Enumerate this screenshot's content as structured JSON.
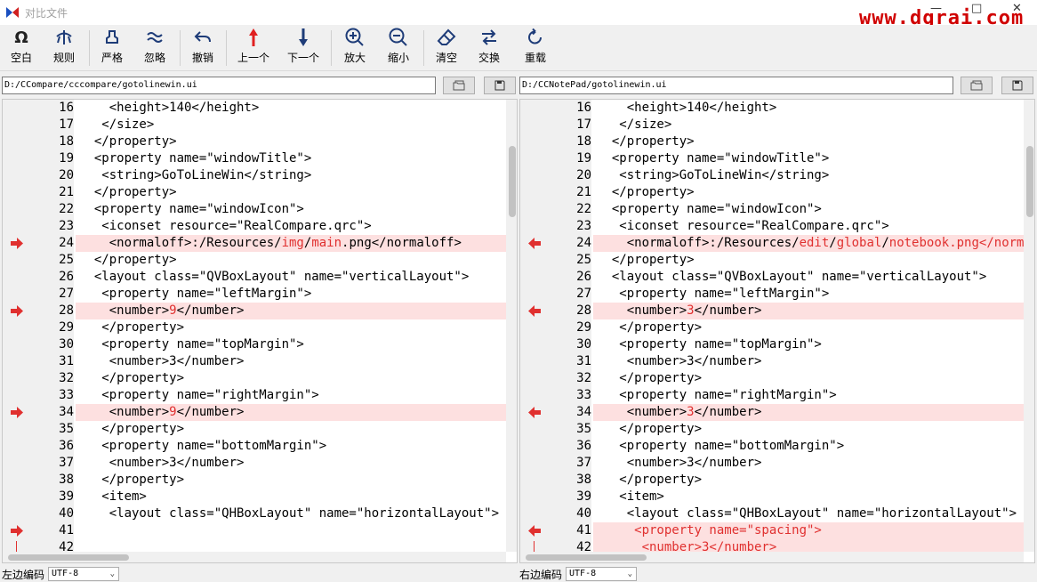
{
  "window": {
    "title": "对比文件",
    "watermark": "www.dgrai.com",
    "minimize": "—",
    "maximize": "□",
    "close": "✕"
  },
  "toolbar": {
    "blank": "空白",
    "rules": "规则",
    "strict": "严格",
    "ignore": "忽略",
    "undo": "撤销",
    "prev": "上一个",
    "next": "下一个",
    "zoom_in": "放大",
    "zoom_out": "缩小",
    "clear": "清空",
    "swap": "交换",
    "reload": "重载"
  },
  "left": {
    "path": "D:/CCompare/cccompare/gotolinewin.ui",
    "encoding_label": "左边编码",
    "encoding": "UTF-8",
    "lines": [
      {
        "n": "16",
        "segs": [
          {
            "t": "    <height>140</height>"
          }
        ]
      },
      {
        "n": "17",
        "segs": [
          {
            "t": "   </size>"
          }
        ]
      },
      {
        "n": "18",
        "segs": [
          {
            "t": "  </property>"
          }
        ]
      },
      {
        "n": "19",
        "segs": [
          {
            "t": "  <property name=\"windowTitle\">"
          }
        ]
      },
      {
        "n": "20",
        "segs": [
          {
            "t": "   <string>GoToLineWin</string>"
          }
        ]
      },
      {
        "n": "21",
        "segs": [
          {
            "t": "  </property>"
          }
        ]
      },
      {
        "n": "22",
        "segs": [
          {
            "t": "  <property name=\"windowIcon\">"
          }
        ]
      },
      {
        "n": "23",
        "segs": [
          {
            "t": "   <iconset resource=\"RealCompare.qrc\">"
          }
        ]
      },
      {
        "n": "24",
        "diff": true,
        "segs": [
          {
            "t": "    <normaloff>:/Resources/"
          },
          {
            "t": "img",
            "r": true
          },
          {
            "t": "/"
          },
          {
            "t": "main",
            "r": true
          },
          {
            "t": ".png</normaloff>"
          }
        ]
      },
      {
        "n": "25",
        "segs": [
          {
            "t": "  </property>"
          }
        ]
      },
      {
        "n": "26",
        "segs": [
          {
            "t": "  <layout class=\"QVBoxLayout\" name=\"verticalLayout\">"
          }
        ]
      },
      {
        "n": "27",
        "segs": [
          {
            "t": "   <property name=\"leftMargin\">"
          }
        ]
      },
      {
        "n": "28",
        "diff": true,
        "segs": [
          {
            "t": "    <number>"
          },
          {
            "t": "9",
            "r": true
          },
          {
            "t": "</number>"
          }
        ]
      },
      {
        "n": "29",
        "segs": [
          {
            "t": "   </property>"
          }
        ]
      },
      {
        "n": "30",
        "segs": [
          {
            "t": "   <property name=\"topMargin\">"
          }
        ]
      },
      {
        "n": "31",
        "segs": [
          {
            "t": "    <number>3</number>"
          }
        ]
      },
      {
        "n": "32",
        "segs": [
          {
            "t": "   </property>"
          }
        ]
      },
      {
        "n": "33",
        "segs": [
          {
            "t": "   <property name=\"rightMargin\">"
          }
        ]
      },
      {
        "n": "34",
        "diff": true,
        "segs": [
          {
            "t": "    <number>"
          },
          {
            "t": "9",
            "r": true
          },
          {
            "t": "</number>"
          }
        ]
      },
      {
        "n": "35",
        "segs": [
          {
            "t": "   </property>"
          }
        ]
      },
      {
        "n": "36",
        "segs": [
          {
            "t": "   <property name=\"bottomMargin\">"
          }
        ]
      },
      {
        "n": "37",
        "segs": [
          {
            "t": "    <number>3</number>"
          }
        ]
      },
      {
        "n": "38",
        "segs": [
          {
            "t": "   </property>"
          }
        ]
      },
      {
        "n": "39",
        "segs": [
          {
            "t": "   <item>"
          }
        ]
      },
      {
        "n": "40",
        "segs": [
          {
            "t": "    <layout class=\"QHBoxLayout\" name=\"horizontalLayout\">"
          }
        ]
      },
      {
        "n": "41",
        "hatch": true,
        "segs": [
          {
            "t": ""
          }
        ]
      },
      {
        "n": "42",
        "hatch": true,
        "segs": [
          {
            "t": ""
          }
        ]
      }
    ]
  },
  "right": {
    "path": "D:/CCNotePad/gotolinewin.ui",
    "encoding_label": "右边编码",
    "encoding": "UTF-8",
    "lines": [
      {
        "n": "16",
        "segs": [
          {
            "t": "    <height>140</height>"
          }
        ]
      },
      {
        "n": "17",
        "segs": [
          {
            "t": "   </size>"
          }
        ]
      },
      {
        "n": "18",
        "segs": [
          {
            "t": "  </property>"
          }
        ]
      },
      {
        "n": "19",
        "segs": [
          {
            "t": "  <property name=\"windowTitle\">"
          }
        ]
      },
      {
        "n": "20",
        "segs": [
          {
            "t": "   <string>GoToLineWin</string>"
          }
        ]
      },
      {
        "n": "21",
        "segs": [
          {
            "t": "  </property>"
          }
        ]
      },
      {
        "n": "22",
        "segs": [
          {
            "t": "  <property name=\"windowIcon\">"
          }
        ]
      },
      {
        "n": "23",
        "segs": [
          {
            "t": "   <iconset resource=\"RealCompare.qrc\">"
          }
        ]
      },
      {
        "n": "24",
        "diff": true,
        "segs": [
          {
            "t": "    <normaloff>:/Resources/"
          },
          {
            "t": "edit",
            "r": true
          },
          {
            "t": "/"
          },
          {
            "t": "global",
            "r": true
          },
          {
            "t": "/"
          },
          {
            "t": "n",
            "r": true
          },
          {
            "t": "otebook.png</normaloff>",
            "r": true
          }
        ]
      },
      {
        "n": "25",
        "segs": [
          {
            "t": "  </property>"
          }
        ]
      },
      {
        "n": "26",
        "segs": [
          {
            "t": "  <layout class=\"QVBoxLayout\" name=\"verticalLayout\">"
          }
        ]
      },
      {
        "n": "27",
        "segs": [
          {
            "t": "   <property name=\"leftMargin\">"
          }
        ]
      },
      {
        "n": "28",
        "diff": true,
        "segs": [
          {
            "t": "    <number>"
          },
          {
            "t": "3",
            "r": true
          },
          {
            "t": "</number>"
          }
        ]
      },
      {
        "n": "29",
        "segs": [
          {
            "t": "   </property>"
          }
        ]
      },
      {
        "n": "30",
        "segs": [
          {
            "t": "   <property name=\"topMargin\">"
          }
        ]
      },
      {
        "n": "31",
        "segs": [
          {
            "t": "    <number>3</number>"
          }
        ]
      },
      {
        "n": "32",
        "segs": [
          {
            "t": "   </property>"
          }
        ]
      },
      {
        "n": "33",
        "segs": [
          {
            "t": "   <property name=\"rightMargin\">"
          }
        ]
      },
      {
        "n": "34",
        "diff": true,
        "segs": [
          {
            "t": "    <number>"
          },
          {
            "t": "3",
            "r": true
          },
          {
            "t": "</number>"
          }
        ]
      },
      {
        "n": "35",
        "segs": [
          {
            "t": "   </property>"
          }
        ]
      },
      {
        "n": "36",
        "segs": [
          {
            "t": "   <property name=\"bottomMargin\">"
          }
        ]
      },
      {
        "n": "37",
        "segs": [
          {
            "t": "    <number>3</number>"
          }
        ]
      },
      {
        "n": "38",
        "segs": [
          {
            "t": "   </property>"
          }
        ]
      },
      {
        "n": "39",
        "segs": [
          {
            "t": "   <item>"
          }
        ]
      },
      {
        "n": "40",
        "segs": [
          {
            "t": "    <layout class=\"QHBoxLayout\" name=\"horizontalLayout\">"
          }
        ]
      },
      {
        "n": "41",
        "diff": true,
        "segs": [
          {
            "t": "     <property name=\"spacing\">",
            "r": true
          }
        ]
      },
      {
        "n": "42",
        "diff": true,
        "segs": [
          {
            "t": "      <number>3</number>",
            "r": true
          }
        ]
      }
    ]
  }
}
